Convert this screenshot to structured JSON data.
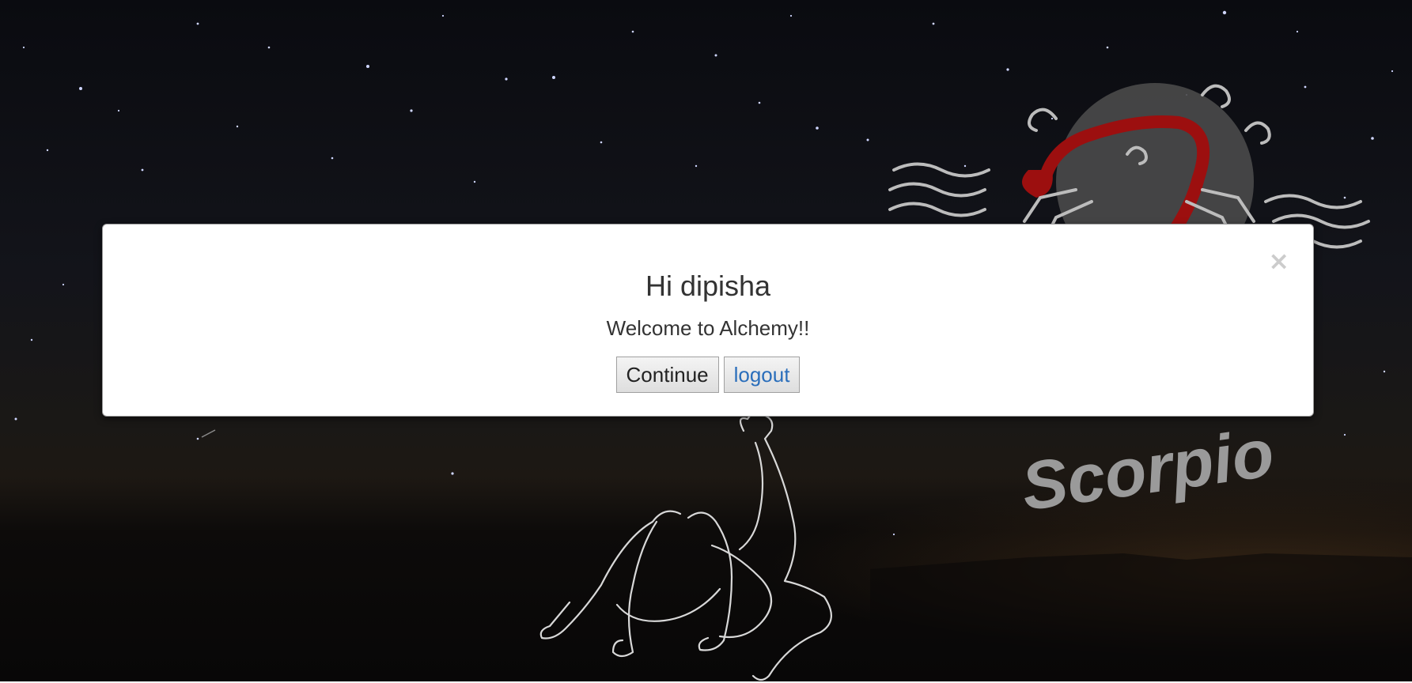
{
  "background": {
    "logo_text": "Scorpio",
    "sky_color": "#0a0b10",
    "horizon_glow": "#5a3a1c",
    "scorpion_accent": "#9c0f0f"
  },
  "modal": {
    "close_label": "×",
    "title": "Hi dipisha",
    "message": "Welcome to Alchemy!!",
    "continue_label": "Continue",
    "logout_label": "logout",
    "logout_color": "#2a6ebb"
  }
}
